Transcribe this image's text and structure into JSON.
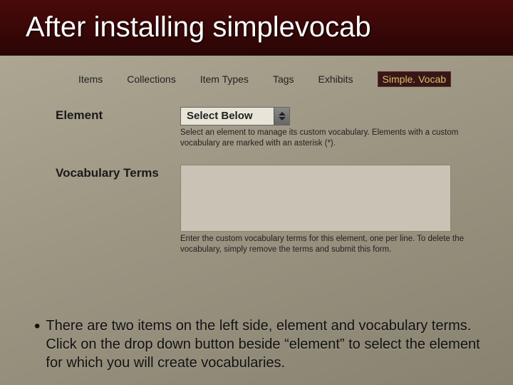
{
  "title": "After installing simplevocab",
  "nav": {
    "items": [
      "Items",
      "Collections",
      "Item Types",
      "Tags",
      "Exhibits"
    ],
    "active": "Simple. Vocab"
  },
  "form": {
    "element": {
      "label": "Element",
      "selected": "Select Below",
      "help": "Select an element to manage its custom vocabulary. Elements with a custom vocabulary are marked with an asterisk (*)."
    },
    "terms": {
      "label": "Vocabulary Terms",
      "help": "Enter the custom vocabulary terms for this element, one per line. To delete the vocabulary, simply remove the terms and submit this form."
    }
  },
  "bullet": "There are two items on the left side, element and vocabulary terms. Click on the drop down button beside “element” to select the element for which you will create vocabularies."
}
